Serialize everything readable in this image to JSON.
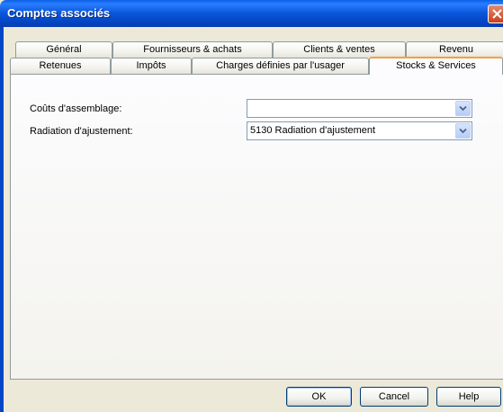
{
  "window": {
    "title": "Comptes associés"
  },
  "tabs_row1": [
    {
      "label": "Général"
    },
    {
      "label": "Fournisseurs & achats"
    },
    {
      "label": "Clients & ventes"
    },
    {
      "label": "Revenu"
    }
  ],
  "tabs_row2": [
    {
      "label": "Retenues"
    },
    {
      "label": "Impôts"
    },
    {
      "label": "Charges définies par l'usager"
    },
    {
      "label": "Stocks & Services"
    }
  ],
  "active_tab": "Stocks & Services",
  "form": {
    "assembly_costs": {
      "label": "Coûts d'assemblage:",
      "value": ""
    },
    "adjustment_writeoff": {
      "label": "Radiation d'ajustement:",
      "value": "5130 Radiation d'ajustement"
    }
  },
  "buttons": {
    "ok": "OK",
    "cancel": "Cancel",
    "help": "Help"
  },
  "colors": {
    "titlebar": "#0447c6",
    "active_tab_accent": "#f0a13c",
    "dialog_bg": "#ece9d8"
  }
}
